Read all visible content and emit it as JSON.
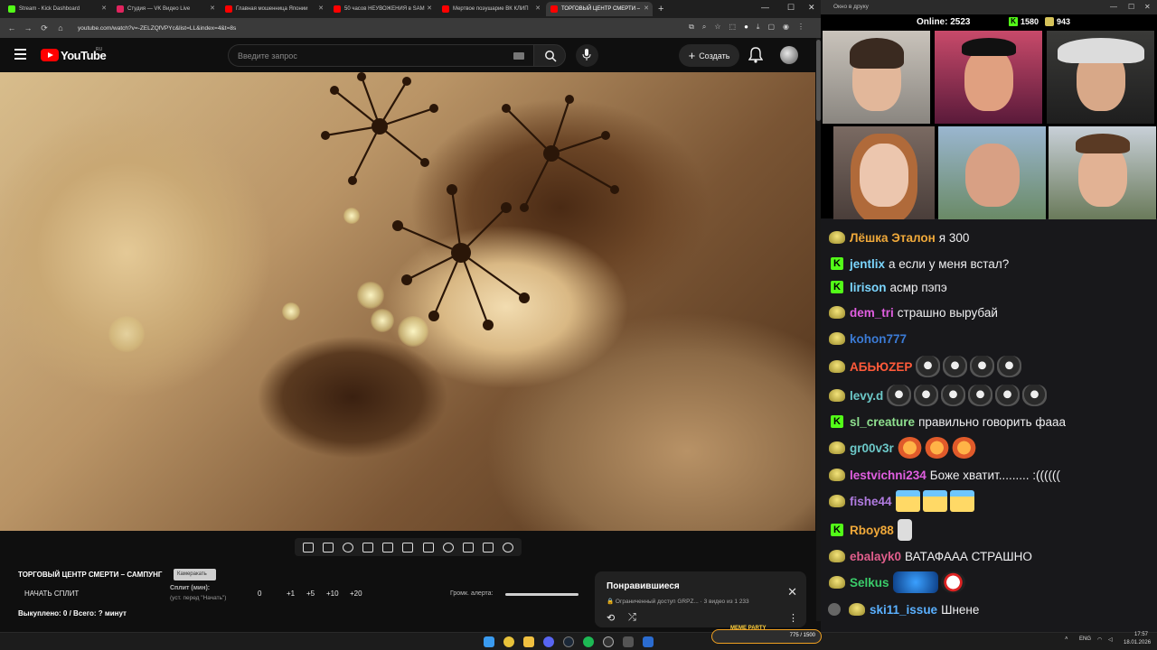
{
  "browser": {
    "tabs": [
      {
        "label": "Stream - Kick Dashboard",
        "color": "#53fc18"
      },
      {
        "label": "Студия — VK Видео Live",
        "color": "#e0245e"
      },
      {
        "label": "Главная мошенница Японии",
        "color": "#ff0000"
      },
      {
        "label": "50 часов НЕУВОЖЕНИЯ в SAM",
        "color": "#ff0000"
      },
      {
        "label": "Мертвое поэушарие ВК КЛИП",
        "color": "#ff0000"
      },
      {
        "label": "ТОРГОВЫЙ ЦЕНТР СМЕРТИ –",
        "color": "#ff0000"
      }
    ],
    "new_tab": "+",
    "url": "youtube.com/watch?v=-ZELZQfVPYc&list=LL&index=4&t=8s"
  },
  "youtube": {
    "logo_text": "YouTube",
    "region": "RU",
    "search_placeholder": "Введите запрос",
    "create_label": "Создать"
  },
  "below_video": {
    "title": "ТОРГОВЫЙ ЦЕНТР СМЕРТИ – САМПУНГ",
    "badge": "Камеракать",
    "split_button": "НАЧАТЬ СПЛИТ",
    "split_label": "Сплит (мин):",
    "split_hint": "(уст. перед \"Начать\")",
    "split_values": [
      "0",
      "+1",
      "+5",
      "+10",
      "+20"
    ],
    "alert_label": "Громк. алерта:",
    "alert_volume": 1.0,
    "paid": "Выкуплено: 0 / Всего: ? минут"
  },
  "liked_popup": {
    "title": "Понравившиеся",
    "subtitle_access": "Ограниченный доступ",
    "subtitle_owner": "GRPZ...",
    "subtitle_count": "· 3 видео из 1 233"
  },
  "right_panel": {
    "window_title": "Окно в друку",
    "online_label": "Online:",
    "online_value": "2523",
    "kick_count": "1580",
    "vk_count": "943"
  },
  "chat": [
    {
      "platform": "vk",
      "user": "Лёшка Эталон",
      "color": "#f0a93a",
      "text": "я 300",
      "emotes": []
    },
    {
      "platform": "kick",
      "user": "jentlix",
      "color": "#7bd6ff",
      "text": "а если у меня встал?",
      "emotes": []
    },
    {
      "platform": "kick",
      "user": "lirison",
      "color": "#7bd6ff",
      "text": "асмр пэпэ",
      "emotes": []
    },
    {
      "platform": "vk",
      "user": "dem_tri",
      "color": "#e05ee0",
      "text": "страшно вырубай",
      "emotes": []
    },
    {
      "platform": "vk",
      "user": "kohon777",
      "color": "#3b7bd6",
      "text": "",
      "emotes": []
    },
    {
      "platform": "vk",
      "user": "АБЬЮZЕР",
      "color": "#ff5a3a",
      "text": "",
      "emotes": [
        "cat",
        "cat",
        "cat",
        "cat"
      ]
    },
    {
      "platform": "vk",
      "user": "levy.d",
      "color": "#6cc8c8",
      "text": "",
      "emotes": [
        "cat",
        "cat",
        "cat",
        "cat",
        "cat",
        "cat"
      ]
    },
    {
      "platform": "kick",
      "user": "sl_creature",
      "color": "#8fe08f",
      "text": "правильно говорить фааа",
      "emotes": []
    },
    {
      "platform": "vk",
      "user": "gr00v3r",
      "color": "#6cc8c8",
      "text": "",
      "emotes": [
        "star",
        "star",
        "star"
      ]
    },
    {
      "platform": "vk",
      "user": "lestvichni234",
      "color": "#e05ee0",
      "text": "Боже хватит......... :((((((",
      "emotes": []
    },
    {
      "platform": "vk",
      "user": "fishe44",
      "color": "#b07be0",
      "text": "",
      "emotes": [
        "pepe",
        "pepe",
        "pepe"
      ]
    },
    {
      "platform": "kick",
      "user": "Rboy88",
      "color": "#f0a93a",
      "text": "",
      "emotes": [
        "hand"
      ]
    },
    {
      "platform": "vk",
      "user": "ebalayk0",
      "color": "#e05e8c",
      "text": "ВАТАФААА СТРАШНО",
      "emotes": []
    },
    {
      "platform": "vk",
      "user": "Selkus",
      "color": "#3acc6a",
      "text": "",
      "emotes": [
        "blue",
        "clown"
      ]
    },
    {
      "platform": "vk-mod",
      "user": "ski11_issue",
      "color": "#5ab0ff",
      "text": "Шнене",
      "emotes": []
    }
  ],
  "taskbar": {
    "meme_party": "MEME PARTY",
    "meme_counter": "775 / 1500",
    "lang": "ENG",
    "time": "17:57",
    "date": "18.01.2026"
  }
}
